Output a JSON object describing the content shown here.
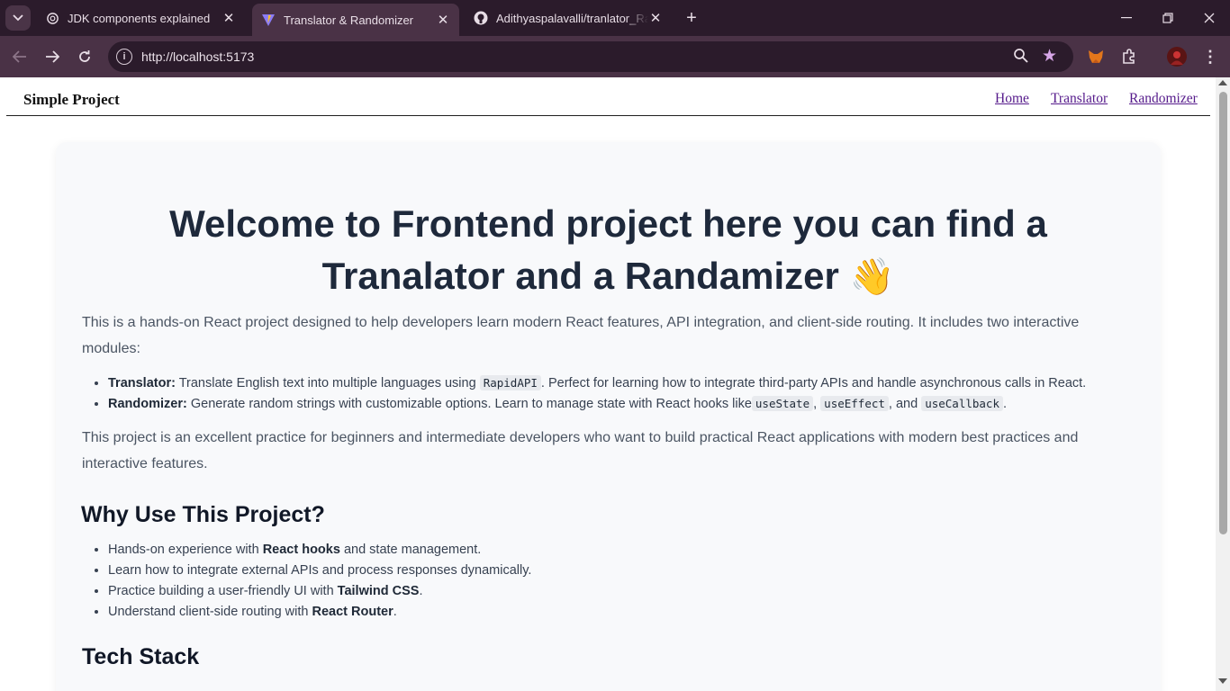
{
  "browser": {
    "tabs": [
      {
        "title": "JDK components explained",
        "icon": "openai-icon"
      },
      {
        "title": "Translator & Randomizer",
        "icon": "vite-icon"
      },
      {
        "title": "Adithyaspalavalli/tranlator_Randomizer",
        "icon": "github-icon"
      }
    ],
    "url": "http://localhost:5173",
    "colors": {
      "frame": "#2b1b2b",
      "toolbar": "#4a3246",
      "star": "#d7a6e8"
    }
  },
  "site": {
    "brand": "Simple Project",
    "nav": [
      "Home",
      "Translator",
      "Randomizer"
    ],
    "link_color": "#551a8b"
  },
  "content": {
    "hero_line1": "Welcome to Frontend project here you can find a",
    "hero_line2": "Tranalator and a Randamizer",
    "hero_emoji": "👋",
    "intro": "This is a hands-on React project designed to help developers learn modern React features, API integration, and client-side routing. It includes two interactive modules:",
    "modules": [
      {
        "name": "Translator:",
        "pre": "Translate English text into multiple languages using",
        "code": "RapidAPI",
        "post": ". Perfect for learning how to integrate third-party APIs and handle asynchronous calls in React."
      },
      {
        "name": "Randomizer:",
        "pre": "Generate random strings with customizable options. Learn to manage state with React hooks like",
        "code1": "useState",
        "sep1": ",",
        "code2": "useEffect",
        "sep2": ", and",
        "code3": "useCallback",
        "post": "."
      }
    ],
    "summary": "This project is an excellent practice for beginners and intermediate developers who want to build practical React applications with modern best practices and interactive features.",
    "why_heading": "Why Use This Project?",
    "why": [
      {
        "pre": "Hands-on experience with",
        "bold": "React hooks",
        "post": "and state management."
      },
      {
        "text": "Learn how to integrate external APIs and process responses dynamically."
      },
      {
        "pre": "Practice building a user-friendly UI with",
        "bold": "Tailwind CSS",
        "post": "."
      },
      {
        "pre": "Understand client-side routing with",
        "bold": "React Router",
        "post": "."
      }
    ],
    "tech_heading": "Tech Stack"
  }
}
